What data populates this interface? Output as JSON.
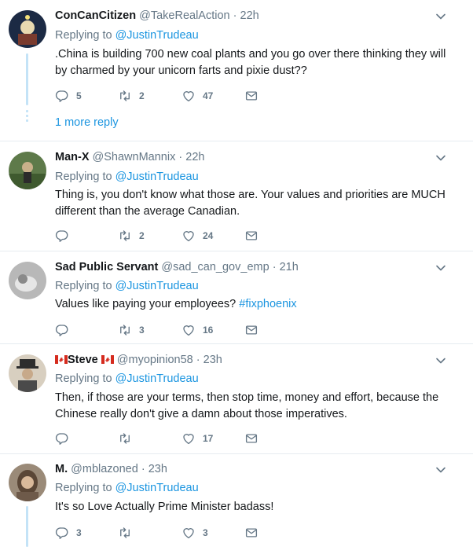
{
  "colors": {
    "link": "#1b95e0",
    "muted": "#657786",
    "thread": "#c4e3f7"
  },
  "tweets": [
    {
      "name": "ConCanCitizen",
      "handle": "@TakeRealAction",
      "dot": "·",
      "time": "22h",
      "replying_prefix": "Replying to",
      "replying_to": "@JustinTrudeau",
      "text_line1": ".China is building 700 new coal plants and you go over there thinking they will",
      "text_line2": "by charmed by your unicorn farts and pixie dust??",
      "replies": "5",
      "retweets": "2",
      "likes": "47",
      "more_replies": "1 more reply"
    },
    {
      "name": "Man-X",
      "handle": "@ShawnMannix",
      "dot": "·",
      "time": "22h",
      "replying_prefix": "Replying to",
      "replying_to": "@JustinTrudeau",
      "text_line1": "Thing is, you don't know what those are. Your values and priorities are MUCH",
      "text_line2": "different than the average Canadian.",
      "replies": "",
      "retweets": "2",
      "likes": "24"
    },
    {
      "name": "Sad Public Servant",
      "handle": "@sad_can_gov_emp",
      "dot": "·",
      "time": "21h",
      "replying_prefix": "Replying to",
      "replying_to": "@JustinTrudeau",
      "text_line1": "Values like paying your employees?",
      "hashtag": "#fixphoenix",
      "replies": "",
      "retweets": "3",
      "likes": "16"
    },
    {
      "name": "Steve",
      "handle": "@myopinion58",
      "dot": "·",
      "time": "23h",
      "replying_prefix": "Replying to",
      "replying_to": "@JustinTrudeau",
      "text_line1": "Then, if those are your terms, then stop time, money and effort, because the",
      "text_line2": "Chinese really don't give a damn about those imperatives.",
      "replies": "",
      "retweets": "",
      "likes": "17"
    },
    {
      "name": "M.",
      "handle": "@mblazoned",
      "dot": "·",
      "time": "23h",
      "replying_prefix": "Replying to",
      "replying_to": "@JustinTrudeau",
      "text_line1": "It's so Love Actually Prime Minister badass!",
      "replies": "3",
      "retweets": "",
      "likes": "3"
    }
  ]
}
